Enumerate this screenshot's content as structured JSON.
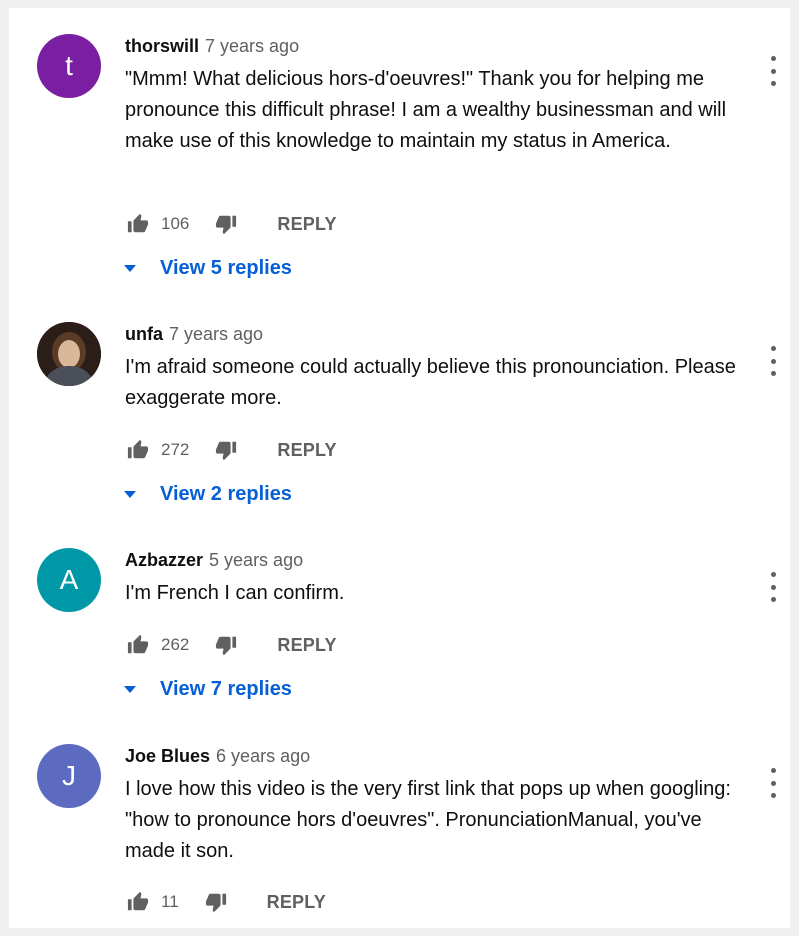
{
  "comments": [
    {
      "author": "thorswill",
      "time": "7 years ago",
      "avatar_letter": "t",
      "avatar_color": "#7b1fa2",
      "text": "\"Mmm! What delicious hors-d'oeuvres!\" Thank you for helping me pronounce this difficult phrase! I am a wealthy businessman and will make use of this knowledge to maintain my status in America.",
      "likes": "106",
      "reply_label": "REPLY",
      "view_replies": "View 5 replies"
    },
    {
      "author": "unfa",
      "time": "7 years ago",
      "avatar_letter": "",
      "avatar_color": "#3a2a22",
      "text": "I'm afraid someone could actually believe this pronounciation. Please exaggerate more.",
      "likes": "272",
      "reply_label": "REPLY",
      "view_replies": "View 2 replies"
    },
    {
      "author": "Azbazzer",
      "time": "5 years ago",
      "avatar_letter": "A",
      "avatar_color": "#0097a7",
      "text": "I'm French I can confirm.",
      "likes": "262",
      "reply_label": "REPLY",
      "view_replies": "View 7 replies"
    },
    {
      "author": "Joe Blues",
      "time": "6 years ago",
      "avatar_letter": "J",
      "avatar_color": "#5c6bc0",
      "text": "I love how this video is the very first link that pops up when googling: \"how to pronounce hors d'oeuvres\". PronunciationManual, you've made it son.",
      "likes": "11",
      "reply_label": "REPLY"
    }
  ],
  "colors": {
    "link_blue": "#065fd4",
    "secondary_text": "#606060"
  },
  "icons": [
    "thumb-up-icon",
    "thumb-down-icon",
    "more-vert-icon",
    "caret-down-icon"
  ]
}
